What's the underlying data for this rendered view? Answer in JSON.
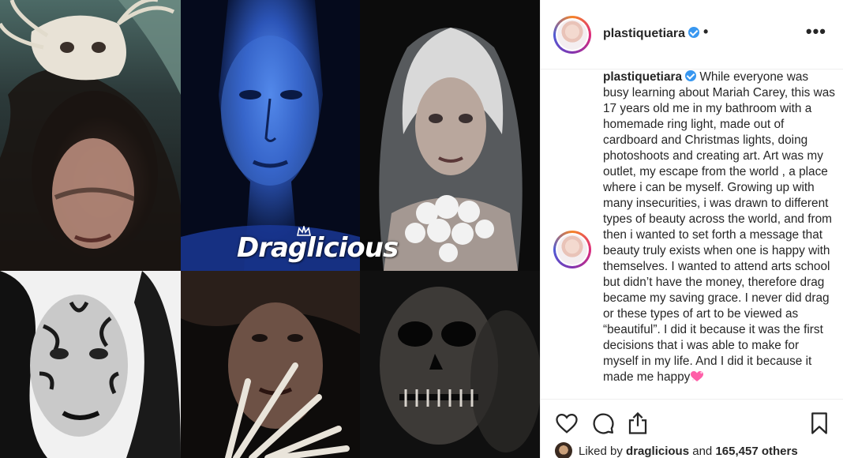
{
  "post": {
    "username": "plastiquetiara",
    "separator": "•",
    "more_label": "•••",
    "caption": "While everyone was busy learning about Mariah Carey, this was 17 years old me in my bathroom with a homemade ring light, made out of cardboard and Christmas lights, doing photoshoots and creating art. Art was my outlet, my escape from the world , a place where i can be myself. Growing up with many insecurities, i was drawn to different types of beauty across the world, and from then i wanted to set forth a message that beauty truly exists when one is happy with themselves. I wanted to attend arts school but didn’t have the money, therefore drag became my saving grace. I never did drag or these types of art to be viewed as “beautiful”. I did it because it was the first decisions that i was able to make for myself in my life. And I did it because it made me happy"
  },
  "likes": {
    "prefix": "Liked by",
    "user": "draglicious",
    "connector": "and",
    "count": "165,457 others"
  },
  "watermark": {
    "text": "Draglicious"
  },
  "icons": {
    "like": "heart-outline-icon",
    "comment": "comment-bubble-icon",
    "share": "share-icon",
    "save": "bookmark-icon",
    "verified": "verified-badge-icon",
    "caption_emoji": "sparkling-heart-icon"
  },
  "colors": {
    "verified_blue": "#3897f0",
    "text": "#262626",
    "divider": "#efefef",
    "emoji_pink": "#ff5fa8"
  }
}
